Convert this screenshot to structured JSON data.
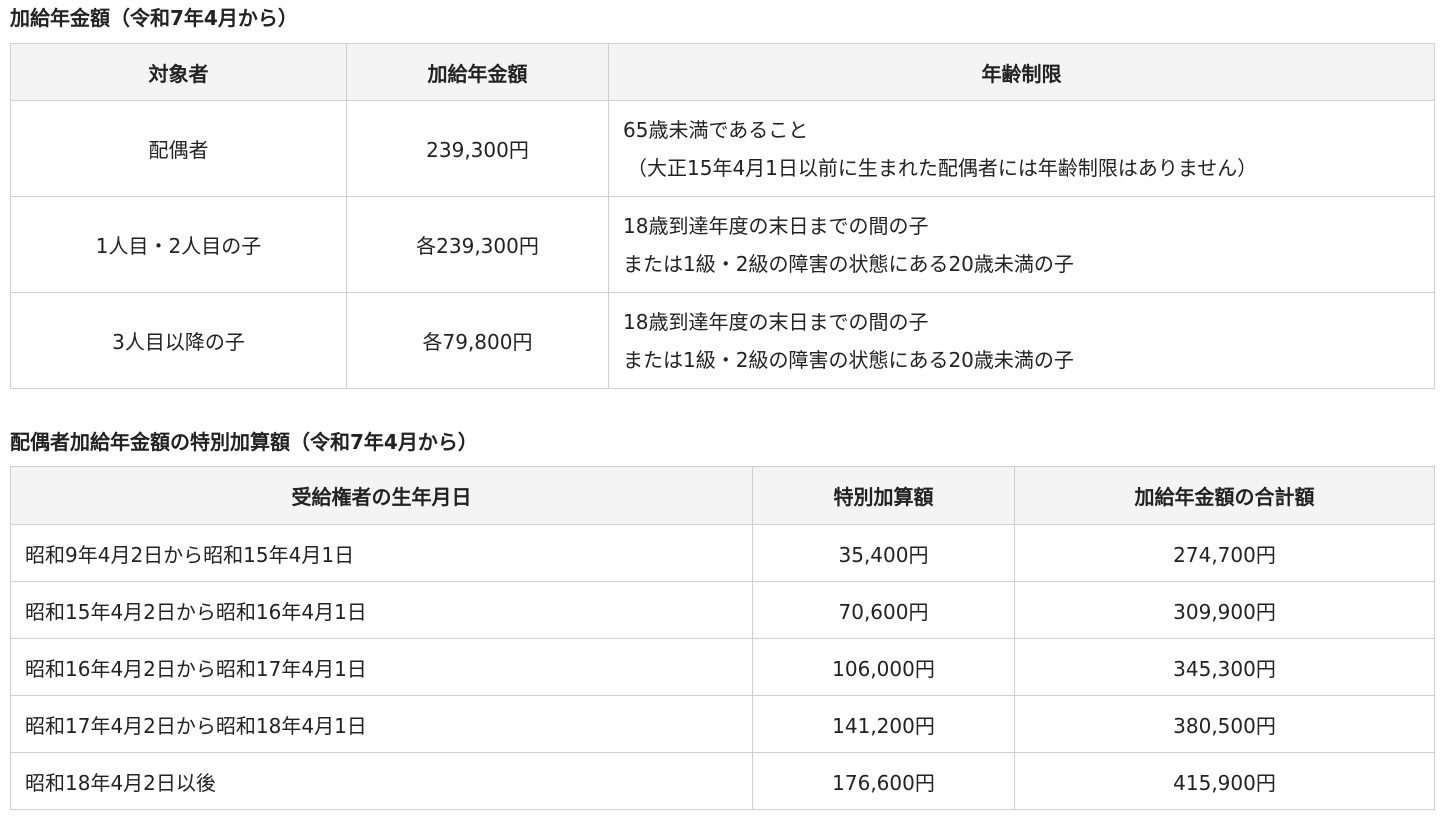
{
  "section1": {
    "title": "加給年金額（令和7年4月から）",
    "headers": [
      "対象者",
      "加給年金額",
      "年齢制限"
    ],
    "rows": [
      {
        "target": "配偶者",
        "amount": "239,300円",
        "limit_lines": [
          "65歳未満であること",
          "（大正15年4月1日以前に生まれた配偶者には年齢制限はありません）"
        ]
      },
      {
        "target": "1人目・2人目の子",
        "amount": "各239,300円",
        "limit_lines": [
          "18歳到達年度の末日までの間の子",
          "または1級・2級の障害の状態にある20歳未満の子"
        ]
      },
      {
        "target": "3人目以降の子",
        "amount": "各79,800円",
        "limit_lines": [
          "18歳到達年度の末日までの間の子",
          "または1級・2級の障害の状態にある20歳未満の子"
        ]
      }
    ]
  },
  "section2": {
    "title": "配偶者加給年金額の特別加算額（令和7年4月から）",
    "headers": [
      "受給権者の生年月日",
      "特別加算額",
      "加給年金額の合計額"
    ],
    "rows": [
      {
        "birth": "昭和9年4月2日から昭和15年4月1日",
        "special": "35,400円",
        "total": "274,700円"
      },
      {
        "birth": "昭和15年4月2日から昭和16年4月1日",
        "special": "70,600円",
        "total": "309,900円"
      },
      {
        "birth": "昭和16年4月2日から昭和17年4月1日",
        "special": "106,000円",
        "total": "345,300円"
      },
      {
        "birth": "昭和17年4月2日から昭和18年4月1日",
        "special": "141,200円",
        "total": "380,500円"
      },
      {
        "birth": "昭和18年4月2日以後",
        "special": "176,600円",
        "total": "415,900円"
      }
    ]
  }
}
